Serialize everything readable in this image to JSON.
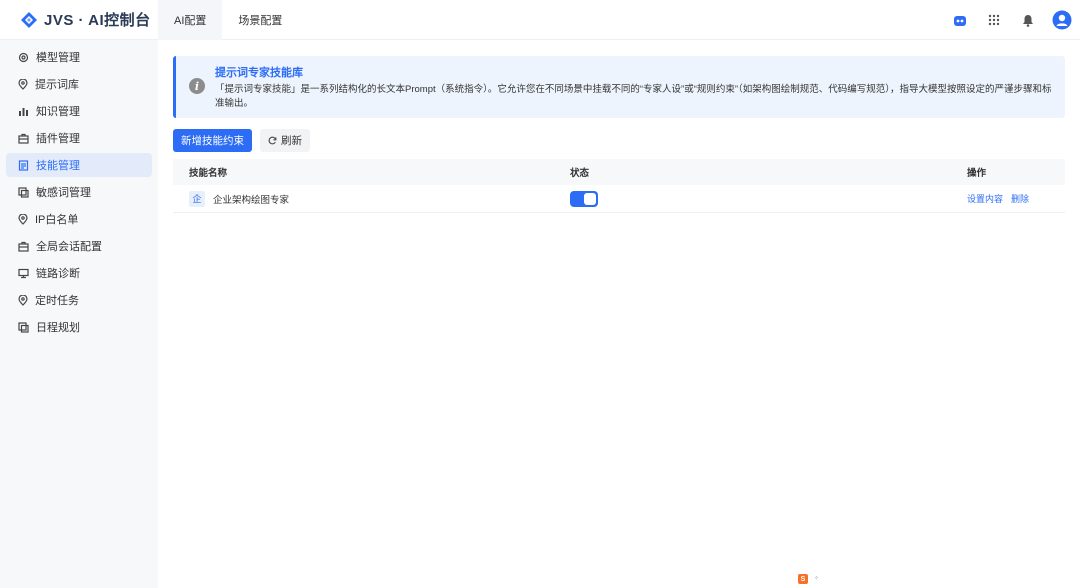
{
  "app": {
    "title": "JVS · AI控制台"
  },
  "top_tabs": [
    {
      "label": "AI配置",
      "active": true
    },
    {
      "label": "场景配置",
      "active": false
    }
  ],
  "header_icons": {
    "badge": ""
  },
  "sidebar": {
    "items": [
      {
        "label": "模型管理",
        "icon": "model-icon",
        "active": false
      },
      {
        "label": "提示词库",
        "icon": "location-pin-icon",
        "active": false
      },
      {
        "label": "知识管理",
        "icon": "bar-chart-icon",
        "active": false
      },
      {
        "label": "插件管理",
        "icon": "briefcase-icon",
        "active": false
      },
      {
        "label": "技能管理",
        "icon": "document-list-icon",
        "active": true
      },
      {
        "label": "敏感词管理",
        "icon": "copy-icon",
        "active": false
      },
      {
        "label": "IP白名单",
        "icon": "location-pin-icon",
        "active": false
      },
      {
        "label": "全局会话配置",
        "icon": "briefcase-icon",
        "active": false
      },
      {
        "label": "链路诊断",
        "icon": "monitor-icon",
        "active": false
      },
      {
        "label": "定时任务",
        "icon": "location-pin-icon",
        "active": false
      },
      {
        "label": "日程规划",
        "icon": "copy-icon",
        "active": false
      }
    ]
  },
  "info": {
    "title": "提示词专家技能库",
    "description": "「提示词专家技能」是一系列结构化的长文本Prompt（系统指令）。它允许您在不同场景中挂载不同的“专家人设”或“规则约束”（如架构图绘制规范、代码编写规范），指导大模型按照设定的严谨步骤和标准输出。"
  },
  "toolbar": {
    "add_label": "新增技能约束",
    "refresh_label": "刷新"
  },
  "table": {
    "columns": {
      "name": "技能名称",
      "status": "状态",
      "ops": "操作"
    },
    "rows": [
      {
        "icon_text": "企",
        "name": "企业架构绘图专家",
        "enabled": true,
        "op_edit": "设置内容",
        "op_delete": "删除"
      }
    ]
  },
  "colors": {
    "accent": "#2d6df6",
    "sidebar_active_bg": "#e3ebfb",
    "info_bg": "#eef4fd"
  }
}
